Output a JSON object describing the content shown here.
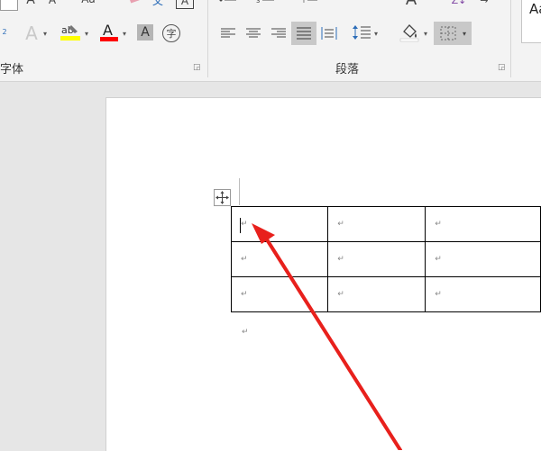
{
  "ribbon": {
    "font_group_label": "字体",
    "paragraph_group_label": "段落",
    "font_buttons": {
      "grow_font": "A",
      "shrink_font": "A",
      "change_case": "Aa",
      "superscript_mark": "2",
      "highlight_label": "ab",
      "font_color": "A",
      "char_shading": "A",
      "enclose_char": "字"
    },
    "heading_button": "A",
    "sort_label": "Z↓",
    "style_sample": "Aa",
    "colors": {
      "highlight": "#ffff00",
      "font_color": "#ff0000",
      "sort_accent": "#7b3fa0"
    }
  },
  "document": {
    "table": {
      "rows": [
        [
          "↵",
          "↵",
          "↵"
        ],
        [
          "↵",
          "↵",
          "↵"
        ],
        [
          "↵",
          "↵",
          "↵"
        ]
      ]
    },
    "after_table_mark": "↵"
  },
  "annotation": {
    "arrow_color": "#e8201c"
  }
}
